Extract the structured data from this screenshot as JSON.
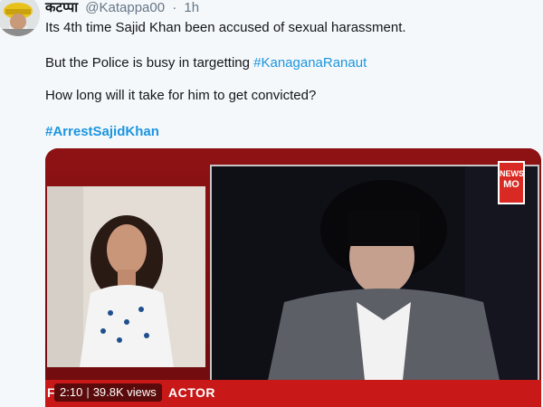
{
  "tweet": {
    "author_name": "कटप्पा",
    "handle": "@Katappa00",
    "separator": "·",
    "time": "1h",
    "line1": "Its 4th time Sajid Khan been accused of sexual harassment.",
    "line2_prefix": "But the Police is busy in targetting ",
    "line2_hashtag": "#KanaganaRanaut",
    "line3": "How long will it take for him to get convicted?",
    "line4_hashtag": "#ArrestSajidKhan"
  },
  "media": {
    "duration": "2:10",
    "views": "39.8K views",
    "ticker_prefix": "F",
    "ticker_text": "ACTOR",
    "channel_logo_top": "NEWS",
    "channel_logo_bottom": "MO"
  },
  "colors": {
    "link": "#1b95e0",
    "ticker": "#c81818",
    "muted": "#657786"
  },
  "icons": {
    "avatar": "avatar-image"
  }
}
